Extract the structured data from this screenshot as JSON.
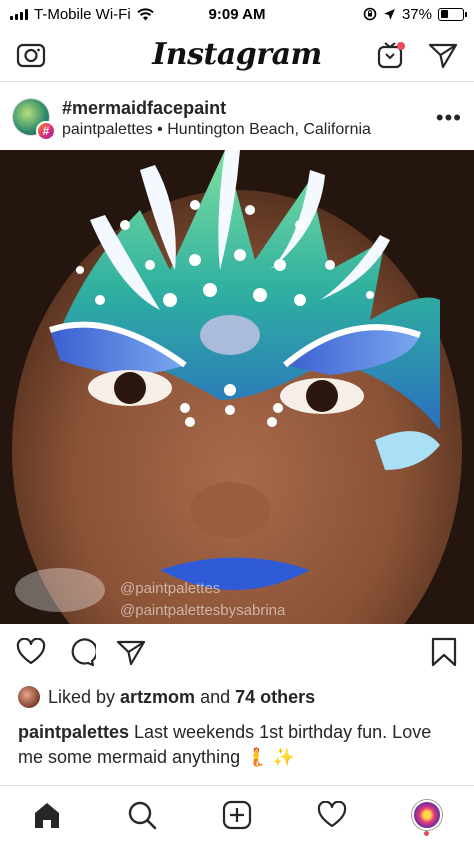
{
  "status_bar": {
    "carrier": "T-Mobile Wi-Fi",
    "time": "9:09 AM",
    "battery": "37%",
    "battery_level": 0.37
  },
  "nav": {
    "title": "Instagram"
  },
  "post": {
    "hashtag": "#mermaidfacepaint",
    "username": "paintpalettes",
    "separator": " • ",
    "location": "Huntington Beach, California",
    "more_label": "•••",
    "watermark": {
      "instagram": "@paintpalettes",
      "facebook": "@paintpalettesbysabrina"
    }
  },
  "likes": {
    "prefix": "Liked by ",
    "user": "artzmom",
    "middle": " and ",
    "others": "74 others"
  },
  "caption": {
    "username": "paintpalettes",
    "text": " Last weekends 1st birthday fun. Love me some mermaid anything 🧜 ✨"
  },
  "colors": {
    "accent_red": "#ed4956",
    "text": "#262626",
    "divider": "#dbdbdb"
  },
  "icons": {
    "camera": "camera-icon",
    "igtv": "igtv-icon",
    "direct": "direct-message-icon",
    "like": "heart-icon",
    "comment": "comment-icon",
    "share": "share-icon",
    "save": "bookmark-icon",
    "home": "home-icon",
    "search": "search-icon",
    "new_post": "new-post-icon",
    "activity": "activity-heart-icon",
    "profile": "profile-icon"
  }
}
